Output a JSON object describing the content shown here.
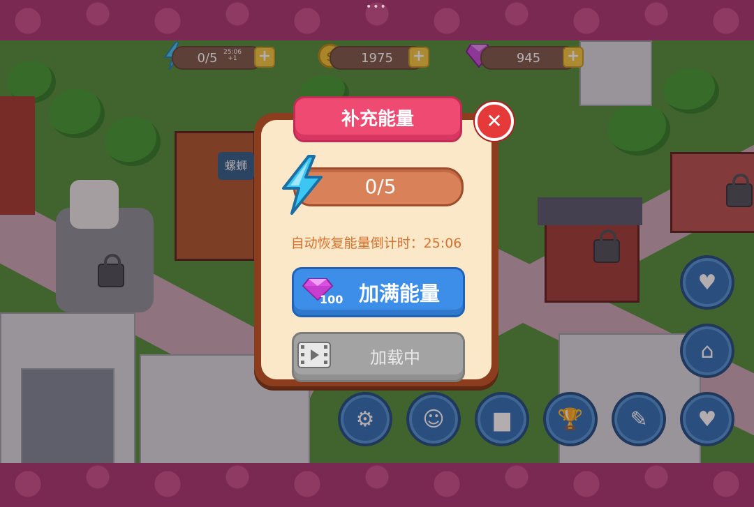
{
  "hud": {
    "energy": "0/5",
    "energy_timer": "25:06",
    "energy_timer_sub": "+1",
    "coins": "1975",
    "gems": "945"
  },
  "scene": {
    "shop_sign": "螺蛳"
  },
  "dialog": {
    "title": "补充能量",
    "energy_value": "0/5",
    "energy_fill": 0,
    "countdown": "自动恢复能量倒计时：25:06",
    "fill_button_label": "加满能量",
    "fill_cost": "100",
    "loading_label": "加载中"
  },
  "icons": {
    "close": "close-icon",
    "energy": "lightning-bolt-icon",
    "coin": "coin-icon",
    "gem": "gem-icon",
    "video": "film-strip-icon"
  },
  "menu": {
    "buttons": [
      "settings",
      "profile",
      "ranking",
      "trophy",
      "notes",
      "recipe-book",
      "shop",
      "roulette"
    ]
  }
}
